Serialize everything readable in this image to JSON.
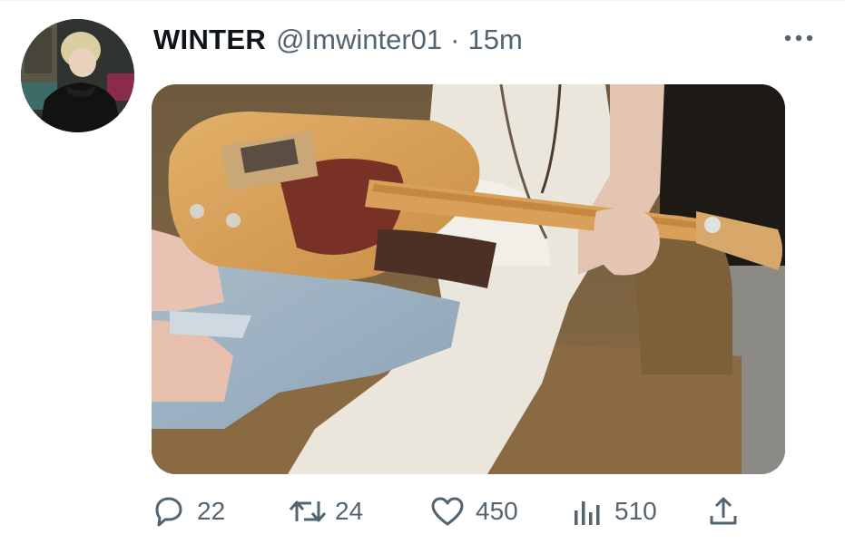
{
  "tweet": {
    "author_name": "WINTER",
    "handle": "@Imwinter01",
    "separator": "·",
    "time": "15m",
    "more_icon": "ellipsis-icon",
    "media_alt_icon": "photo"
  },
  "actions": {
    "reply": {
      "icon": "reply-icon",
      "count": "22"
    },
    "retweet": {
      "icon": "retweet-icon",
      "count": "24"
    },
    "like": {
      "icon": "heart-icon",
      "count": "450"
    },
    "views": {
      "icon": "analytics-icon",
      "count": "510"
    },
    "share": {
      "icon": "share-icon"
    }
  },
  "colors": {
    "text_primary": "#0f1419",
    "text_secondary": "#536471"
  }
}
